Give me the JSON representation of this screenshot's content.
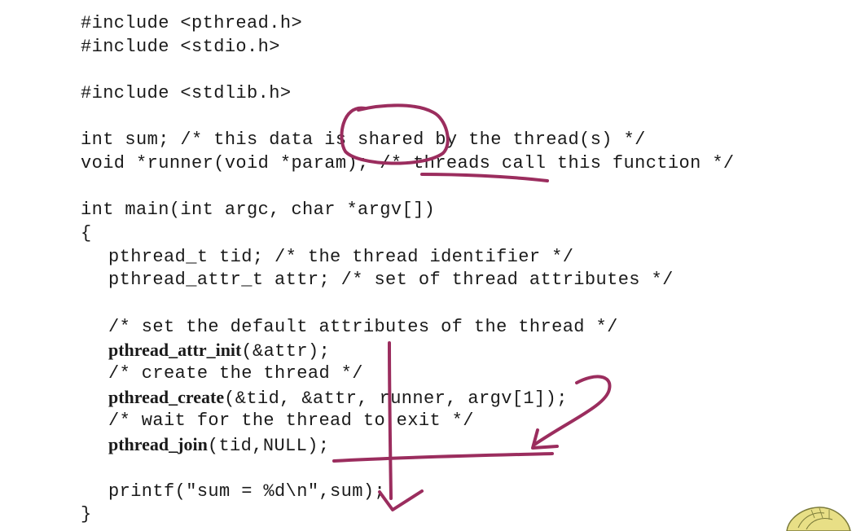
{
  "code": {
    "line_01": "#include <pthread.h>",
    "line_02": "#include <stdio.h>",
    "line_03": "#include <stdlib.h>",
    "line_04": "int sum; /* this data is shared by the thread(s) */",
    "line_05": "void *runner(void *param); /* threads call this function */",
    "line_06": "int main(int argc, char *argv[])",
    "line_07": "{",
    "line_08": "pthread_t tid; /* the thread identifier */",
    "line_09": "pthread_attr_t attr; /* set of thread attributes */",
    "line_10": "/* set the default attributes of the thread */",
    "line_11_fn": "pthread_attr_init",
    "line_11_args": "(&attr);",
    "line_12": "/* create the thread */",
    "line_13_fn": "pthread_create",
    "line_13_args": "(&tid, &attr, runner, argv[1]);",
    "line_14": "/* wait for the thread to exit */",
    "line_15_fn": "pthread_join",
    "line_15_args": "(tid,NULL);",
    "line_16": "printf(\"sum = %d\\n\",sum);",
    "line_17": "}"
  },
  "colors": {
    "text": "#1a1a1a",
    "annotation_ink": "#9b2d5e",
    "background": "#ffffff"
  }
}
